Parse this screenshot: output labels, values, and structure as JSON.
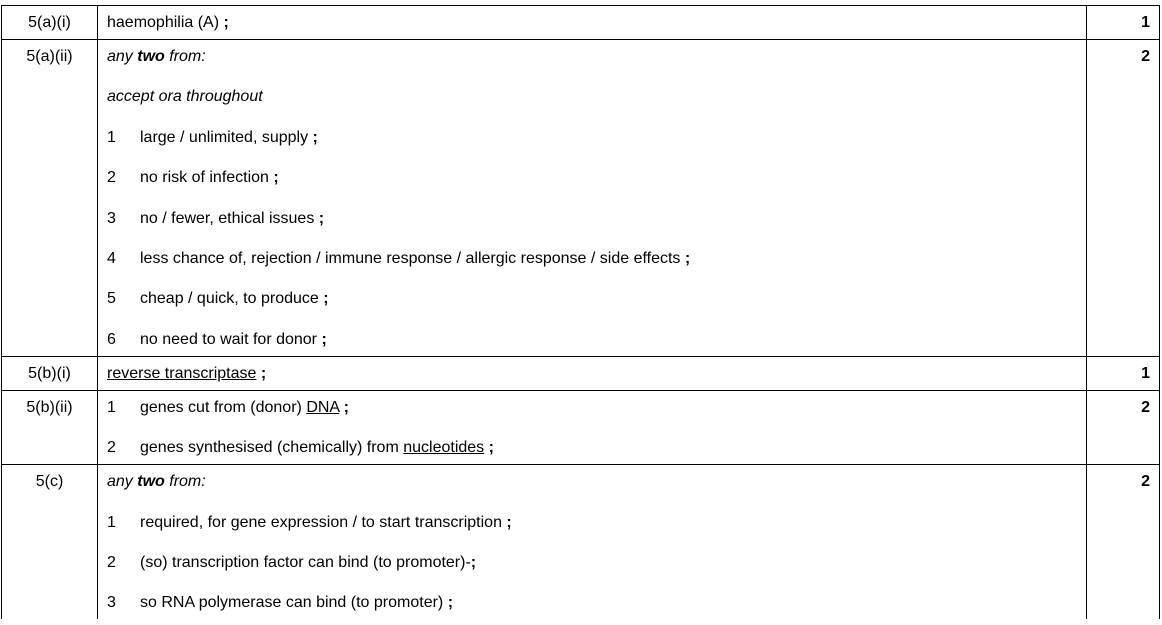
{
  "rows": [
    {
      "question": "5(a)(i)",
      "marks": "1",
      "answer": {
        "text": "haemophilia (A)",
        "semi": ";"
      }
    },
    {
      "question": "5(a)(ii)",
      "marks": "2",
      "header": {
        "pre": "any",
        "bold": "two",
        "post": "from:"
      },
      "note": "accept ora throughout",
      "points": [
        {
          "n": "1",
          "text": "large / unlimited, supply",
          "semi": ";"
        },
        {
          "n": "2",
          "text": "no risk of infection",
          "semi": ";"
        },
        {
          "n": "3",
          "text": "no / fewer, ethical issues",
          "semi": ";"
        },
        {
          "n": "4",
          "text": "less chance of, rejection / immune response / allergic response / side effects",
          "semi": ";"
        },
        {
          "n": "5",
          "text": "cheap / quick, to produce",
          "semi": ";"
        },
        {
          "n": "6",
          "text": "no need to wait for donor",
          "semi": ";"
        }
      ]
    },
    {
      "question": "5(b)(i)",
      "marks": "1",
      "answer": {
        "underlined": "reverse transcriptase",
        "semi": ";"
      }
    },
    {
      "question": "5(b)(ii)",
      "marks": "2",
      "points": [
        {
          "n": "1",
          "pre": "genes cut from (donor)",
          "underlined": "DNA",
          "semi": ";"
        },
        {
          "n": "2",
          "pre": "genes synthesised (chemically) from",
          "underlined": "nucleotides",
          "semi": ";"
        }
      ]
    },
    {
      "question": "5(c)",
      "marks": "2",
      "header": {
        "pre": "any",
        "bold": "two",
        "post": "from:"
      },
      "points": [
        {
          "n": "1",
          "text": "required, for gene expression / to start transcription",
          "semi": ";"
        },
        {
          "n": "2",
          "text": "(so) transcription factor can bind (to promoter)-",
          "semi": ";"
        },
        {
          "n": "3",
          "text": "so RNA polymerase can bind (to promoter)",
          "semi": ";"
        }
      ]
    }
  ]
}
